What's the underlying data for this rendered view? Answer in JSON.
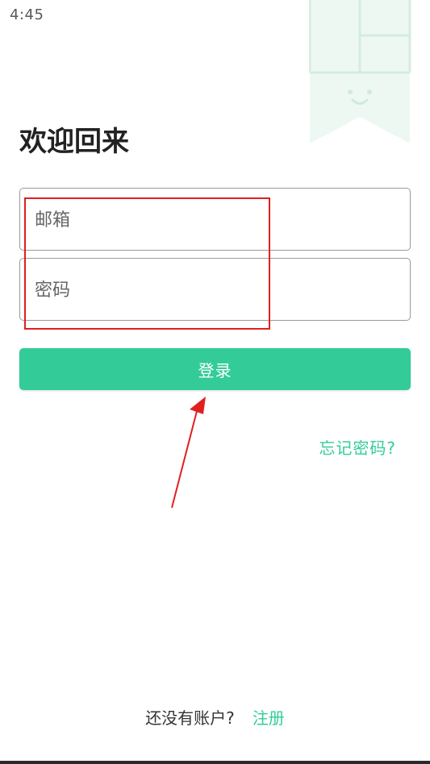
{
  "status_bar": {
    "time": "4:45",
    "icons": [
      "wifi-icon",
      "signal-icon",
      "battery-icon"
    ]
  },
  "login": {
    "title": "欢迎回来",
    "email_placeholder": "邮箱",
    "password_placeholder": "密码",
    "submit_label": "登录",
    "forgot_label": "忘记密码?"
  },
  "footer": {
    "question": "还没有账户?",
    "register_label": "注册"
  },
  "colors": {
    "accent": "#33cc99",
    "annotation": "#e02020",
    "decor": "#dff2ea"
  }
}
